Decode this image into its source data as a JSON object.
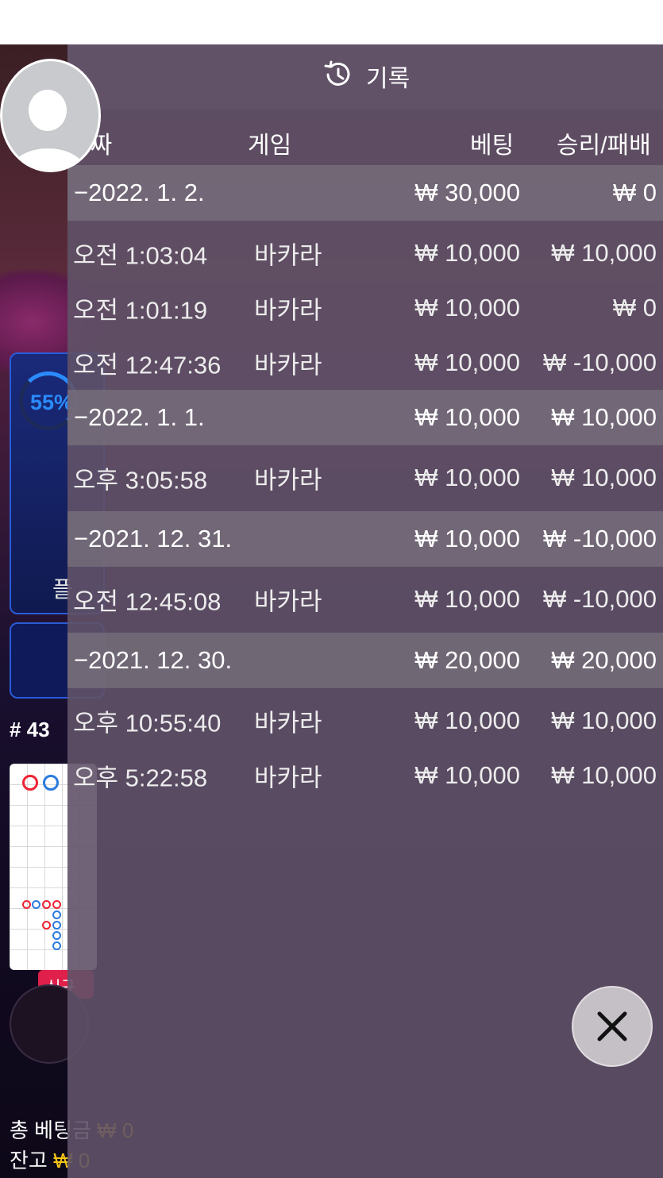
{
  "panel": {
    "title": "기록",
    "icon": "history-icon"
  },
  "columns": {
    "date": "날짜",
    "game": "게임",
    "bet": "베팅",
    "result": "승리/패배"
  },
  "groups": [
    {
      "date": "−2022. 1. 2.",
      "bet": "₩ 30,000",
      "result": "₩ 0",
      "entries": [
        {
          "time": "오전 1:03:04",
          "game": "바카라",
          "bet": "₩ 10,000",
          "result": "₩ 10,000"
        },
        {
          "time": "오전 1:01:19",
          "game": "바카라",
          "bet": "₩ 10,000",
          "result": "₩ 0"
        },
        {
          "time": "오전 12:47:36",
          "game": "바카라",
          "bet": "₩ 10,000",
          "result": "₩ -10,000"
        }
      ]
    },
    {
      "date": "−2022. 1. 1.",
      "bet": "₩ 10,000",
      "result": "₩ 10,000",
      "entries": [
        {
          "time": "오후 3:05:58",
          "game": "바카라",
          "bet": "₩ 10,000",
          "result": "₩ 10,000"
        }
      ]
    },
    {
      "date": "−2021. 12. 31.",
      "bet": "₩ 10,000",
      "result": "₩ -10,000",
      "entries": [
        {
          "time": "오전 12:45:08",
          "game": "바카라",
          "bet": "₩ 10,000",
          "result": "₩ -10,000"
        }
      ]
    },
    {
      "date": "−2021. 12. 30.",
      "bet": "₩ 20,000",
      "result": "₩ 20,000",
      "entries": [
        {
          "time": "오후 10:55:40",
          "game": "바카라",
          "bet": "₩ 10,000",
          "result": "₩ 10,000"
        },
        {
          "time": "오후 5:22:58",
          "game": "바카라",
          "bet": "₩ 10,000",
          "result": "₩ 10,000"
        }
      ]
    }
  ],
  "background": {
    "player_percent": "55%",
    "player_label": "플",
    "round": "# 43",
    "new_badge": "신규",
    "total_bet_label": "총 베팅금",
    "total_bet_value": "₩ 0",
    "balance_label": "잔고",
    "balance_value": "₩ 0"
  },
  "colors": {
    "accent_blue": "#2a8bff",
    "gold": "#f5c518",
    "new_badge": "#e0204a"
  }
}
